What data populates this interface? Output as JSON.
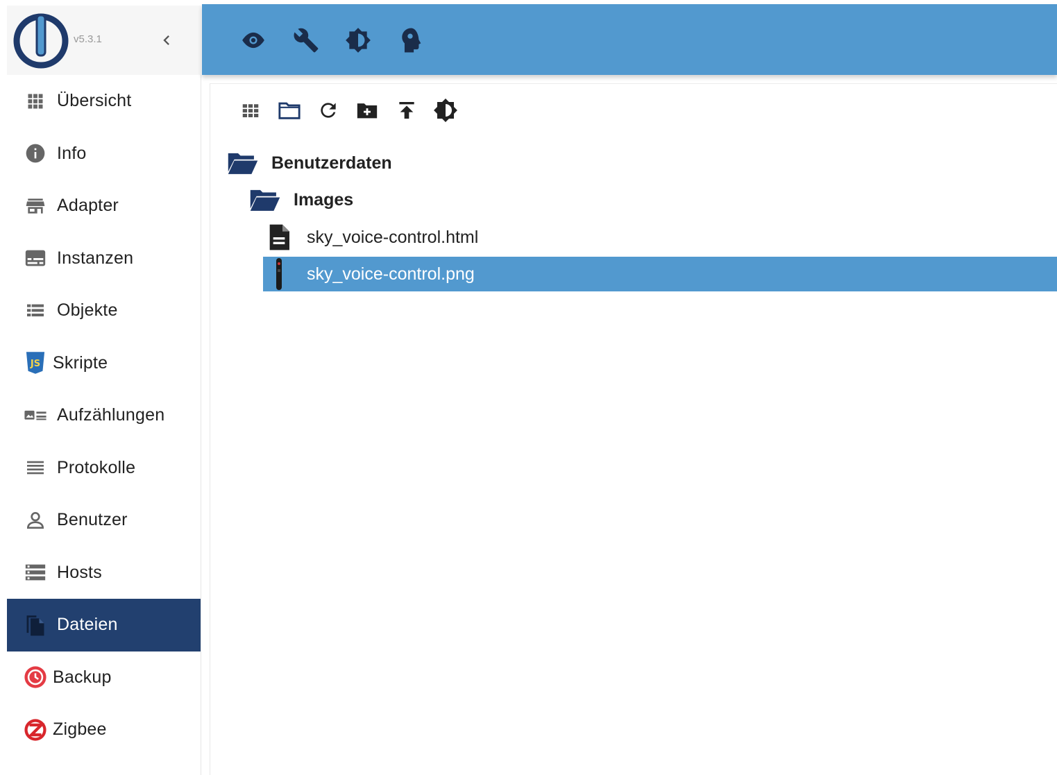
{
  "app": {
    "version": "v5.3.1",
    "accent": "#5299cf",
    "active_bg": "#22406f"
  },
  "sidebar": {
    "items": [
      {
        "label": "Übersicht",
        "icon": "grid-icon"
      },
      {
        "label": "Info",
        "icon": "info-icon"
      },
      {
        "label": "Adapter",
        "icon": "store-icon"
      },
      {
        "label": "Instanzen",
        "icon": "subtitles-icon"
      },
      {
        "label": "Objekte",
        "icon": "list-icon"
      },
      {
        "label": "Skripte",
        "icon": "javascript-icon"
      },
      {
        "label": "Aufzählungen",
        "icon": "picture-list-icon"
      },
      {
        "label": "Protokolle",
        "icon": "lines-icon"
      },
      {
        "label": "Benutzer",
        "icon": "person-icon"
      },
      {
        "label": "Hosts",
        "icon": "storage-icon"
      },
      {
        "label": "Dateien",
        "icon": "files-icon",
        "active": true
      },
      {
        "label": "Backup",
        "icon": "backup-clock-icon"
      },
      {
        "label": "Zigbee",
        "icon": "zigbee-icon"
      }
    ]
  },
  "topbar": {
    "buttons": [
      "eye-icon",
      "wrench-icon",
      "brightness-icon",
      "expert-head-icon"
    ]
  },
  "toolbar": {
    "buttons": [
      "grid-view-icon",
      "folder-icon",
      "refresh-icon",
      "add-folder-icon",
      "upload-icon",
      "brightness-icon"
    ]
  },
  "tree": {
    "root": {
      "label": "Benutzerdaten"
    },
    "folder": {
      "label": "Images"
    },
    "files": [
      {
        "label": "sky_voice-control.html",
        "icon": "document-icon"
      },
      {
        "label": "sky_voice-control.png",
        "icon": "image-thumbnail",
        "selected": true
      }
    ]
  }
}
